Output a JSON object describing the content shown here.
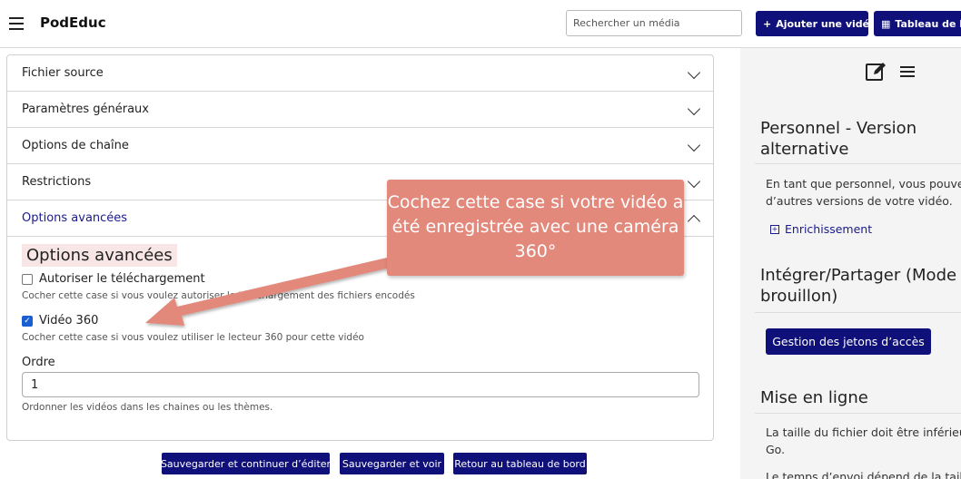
{
  "header": {
    "brand": "PodEduc",
    "search_placeholder": "Rechercher un média",
    "add_video": "Ajouter une vidéo",
    "dashboard": "Tableau de bord"
  },
  "accordion": {
    "items": [
      {
        "label": "Fichier source"
      },
      {
        "label": "Paramètres généraux"
      },
      {
        "label": "Options de chaîne"
      },
      {
        "label": "Restrictions"
      },
      {
        "label": "Options avancées"
      }
    ]
  },
  "advanced": {
    "title": "Options avancées",
    "download_label": "Autoriser le téléchargement",
    "download_checked": false,
    "download_hint": "Cocher cette case si vous voulez autoriser le téléchargement des fichiers encodés",
    "video360_label": "Vidéo 360",
    "video360_checked": true,
    "video360_hint": "Cocher cette case si vous voulez utiliser le lecteur 360 pour cette vidéo",
    "order_label": "Ordre",
    "order_value": "1",
    "order_hint": "Ordonner les vidéos dans les chaines ou les thèmes."
  },
  "actions": {
    "save_continue": "Sauvegarder et continuer d’éditer",
    "save_view": "Sauvegarder et voir",
    "back_dashboard": "Retour au tableau de bord"
  },
  "sidebar": {
    "personal_title": "Personnel - Version alternative",
    "personal_text": "En tant que personnel, vous pouvez d’autres versions de votre vidéo.",
    "enrich_link": "Enrichissement",
    "embed_title": "Intégrer/Partager (Mode brouillon)",
    "tokens_button": "Gestion des jetons d’accès",
    "online_title": "Mise en ligne",
    "online_text1": "La taille du fichier doit être inférieu Go.",
    "online_text2": "Le temps d’envoi dépend de la taille"
  },
  "callout": {
    "text": "Cochez cette case si votre vidéo a été enregistrée avec une caméra 360°"
  },
  "colors": {
    "primary": "#10107a",
    "callout": "#e2897c",
    "sidebar_bg": "#f4f4f4"
  }
}
